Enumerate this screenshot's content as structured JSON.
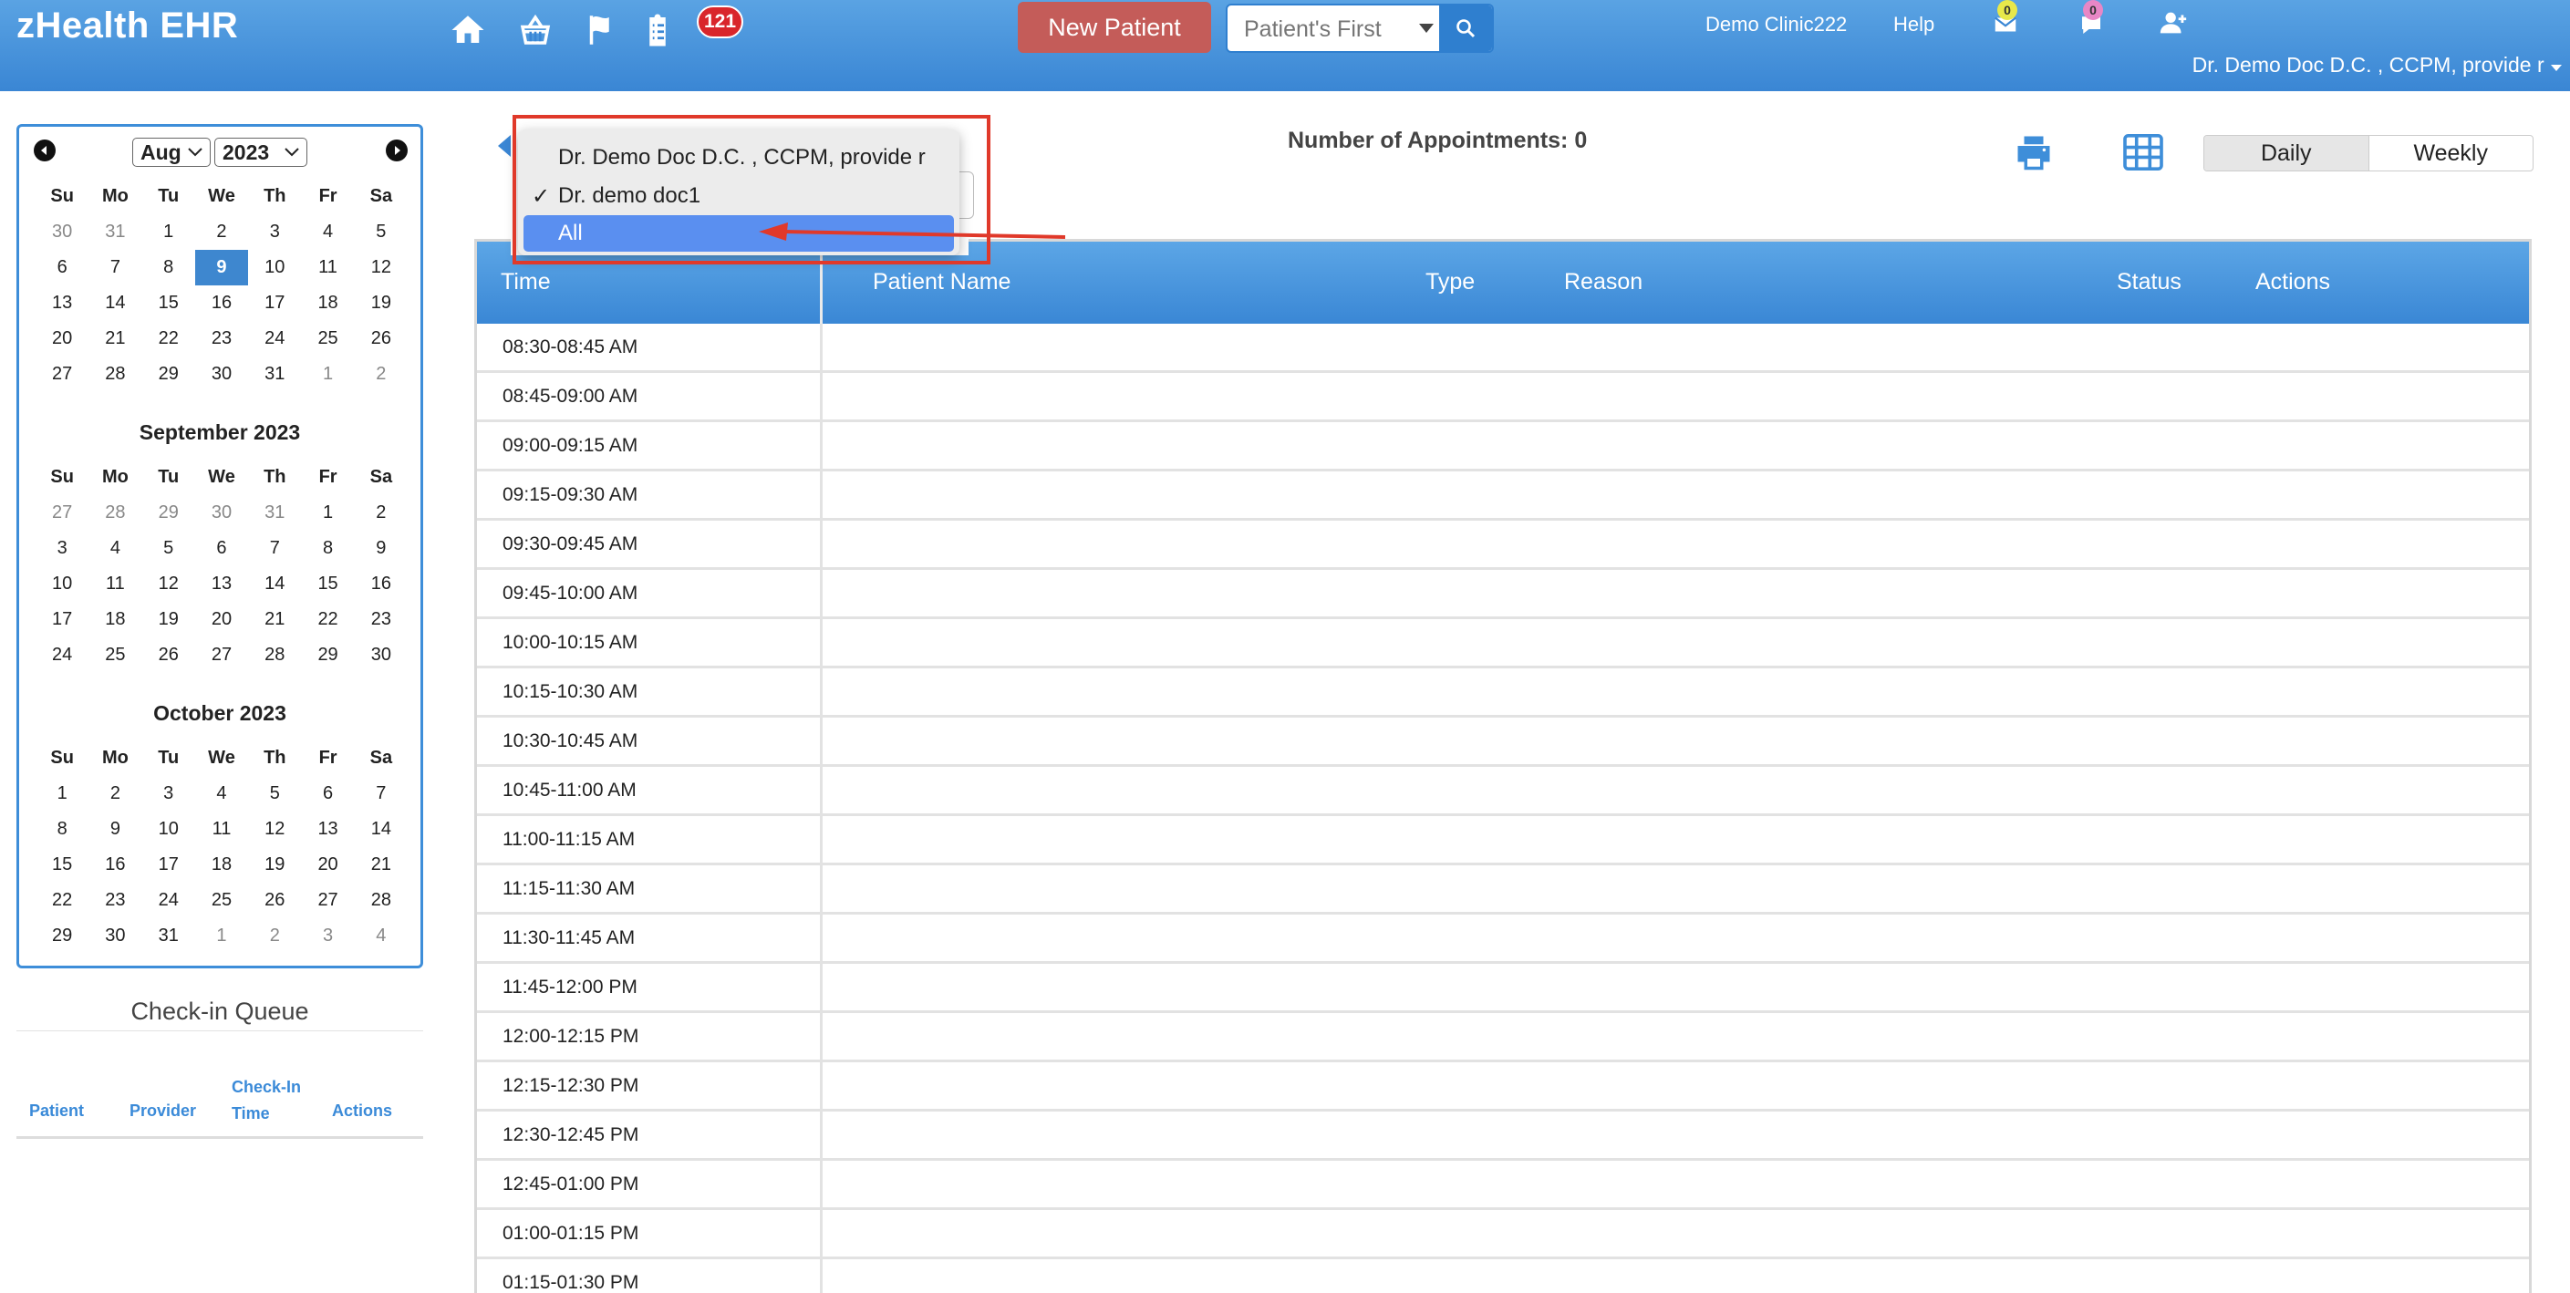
{
  "app": {
    "title": "zHealth EHR",
    "notification_count": "121",
    "new_patient_label": "New Patient",
    "search_placeholder": "Patient's First",
    "clinic_name": "Demo Clinic222",
    "help_label": "Help",
    "mail_count": "0",
    "chat_count": "0",
    "user_label": "Dr. Demo Doc D.C. , CCPM, provide r"
  },
  "colors": {
    "header": "#3a86d4",
    "accent": "#3e87cf",
    "new_patient": "#c45c59",
    "badge_red": "#d9262b",
    "annotation_red": "#e0392a"
  },
  "icons": [
    "home-icon",
    "basket-icon",
    "flag-icon",
    "clipboard-icon",
    "mail-icon",
    "chat-icon",
    "add-user-icon",
    "search-icon",
    "print-icon",
    "grid-icon"
  ],
  "calendar": {
    "month_select": "Aug",
    "year_select": "2023",
    "weekdays": [
      "Su",
      "Mo",
      "Tu",
      "We",
      "Th",
      "Fr",
      "Sa"
    ],
    "months": [
      {
        "title": "",
        "days": [
          {
            "d": "30",
            "o": true
          },
          {
            "d": "31",
            "o": true
          },
          {
            "d": "1"
          },
          {
            "d": "2"
          },
          {
            "d": "3"
          },
          {
            "d": "4"
          },
          {
            "d": "5"
          },
          {
            "d": "6"
          },
          {
            "d": "7"
          },
          {
            "d": "8"
          },
          {
            "d": "9",
            "today": true
          },
          {
            "d": "10"
          },
          {
            "d": "11"
          },
          {
            "d": "12"
          },
          {
            "d": "13"
          },
          {
            "d": "14"
          },
          {
            "d": "15"
          },
          {
            "d": "16"
          },
          {
            "d": "17"
          },
          {
            "d": "18"
          },
          {
            "d": "19"
          },
          {
            "d": "20"
          },
          {
            "d": "21"
          },
          {
            "d": "22"
          },
          {
            "d": "23"
          },
          {
            "d": "24"
          },
          {
            "d": "25"
          },
          {
            "d": "26"
          },
          {
            "d": "27"
          },
          {
            "d": "28"
          },
          {
            "d": "29"
          },
          {
            "d": "30"
          },
          {
            "d": "31"
          },
          {
            "d": "1",
            "o": true
          },
          {
            "d": "2",
            "o": true
          }
        ]
      },
      {
        "title": "September 2023",
        "days": [
          {
            "d": "27",
            "o": true
          },
          {
            "d": "28",
            "o": true
          },
          {
            "d": "29",
            "o": true
          },
          {
            "d": "30",
            "o": true
          },
          {
            "d": "31",
            "o": true
          },
          {
            "d": "1"
          },
          {
            "d": "2"
          },
          {
            "d": "3"
          },
          {
            "d": "4"
          },
          {
            "d": "5"
          },
          {
            "d": "6"
          },
          {
            "d": "7"
          },
          {
            "d": "8"
          },
          {
            "d": "9"
          },
          {
            "d": "10"
          },
          {
            "d": "11"
          },
          {
            "d": "12"
          },
          {
            "d": "13"
          },
          {
            "d": "14"
          },
          {
            "d": "15"
          },
          {
            "d": "16"
          },
          {
            "d": "17"
          },
          {
            "d": "18"
          },
          {
            "d": "19"
          },
          {
            "d": "20"
          },
          {
            "d": "21"
          },
          {
            "d": "22"
          },
          {
            "d": "23"
          },
          {
            "d": "24"
          },
          {
            "d": "25"
          },
          {
            "d": "26"
          },
          {
            "d": "27"
          },
          {
            "d": "28"
          },
          {
            "d": "29"
          },
          {
            "d": "30"
          }
        ]
      },
      {
        "title": "October 2023",
        "days": [
          {
            "d": "1"
          },
          {
            "d": "2"
          },
          {
            "d": "3"
          },
          {
            "d": "4"
          },
          {
            "d": "5"
          },
          {
            "d": "6"
          },
          {
            "d": "7"
          },
          {
            "d": "8"
          },
          {
            "d": "9"
          },
          {
            "d": "10"
          },
          {
            "d": "11"
          },
          {
            "d": "12"
          },
          {
            "d": "13"
          },
          {
            "d": "14"
          },
          {
            "d": "15"
          },
          {
            "d": "16"
          },
          {
            "d": "17"
          },
          {
            "d": "18"
          },
          {
            "d": "19"
          },
          {
            "d": "20"
          },
          {
            "d": "21"
          },
          {
            "d": "22"
          },
          {
            "d": "23"
          },
          {
            "d": "24"
          },
          {
            "d": "25"
          },
          {
            "d": "26"
          },
          {
            "d": "27"
          },
          {
            "d": "28"
          },
          {
            "d": "29"
          },
          {
            "d": "30"
          },
          {
            "d": "31"
          },
          {
            "d": "1",
            "o": true
          },
          {
            "d": "2",
            "o": true
          },
          {
            "d": "3",
            "o": true
          },
          {
            "d": "4",
            "o": true
          }
        ]
      }
    ]
  },
  "checkin_queue": {
    "title": "Check-in Queue",
    "col_patient": "Patient",
    "col_provider": "Provider",
    "col_checkin_1": "Check-In",
    "col_checkin_2": "Time",
    "col_actions": "Actions"
  },
  "schedule": {
    "appointments_label": "Number of Appointments: 0",
    "view_daily": "Daily",
    "view_weekly": "Weekly",
    "columns": {
      "time": "Time",
      "patient_name": "Patient Name",
      "type": "Type",
      "reason": "Reason",
      "status": "Status",
      "actions": "Actions"
    },
    "slots": [
      "08:30-08:45 AM",
      "08:45-09:00 AM",
      "09:00-09:15 AM",
      "09:15-09:30 AM",
      "09:30-09:45 AM",
      "09:45-10:00 AM",
      "10:00-10:15 AM",
      "10:15-10:30 AM",
      "10:30-10:45 AM",
      "10:45-11:00 AM",
      "11:00-11:15 AM",
      "11:15-11:30 AM",
      "11:30-11:45 AM",
      "11:45-12:00 PM",
      "12:00-12:15 PM",
      "12:15-12:30 PM",
      "12:30-12:45 PM",
      "12:45-01:00 PM",
      "01:00-01:15 PM",
      "01:15-01:30 PM"
    ]
  },
  "provider_dropdown": {
    "options": [
      {
        "label": "Dr. Demo Doc D.C. , CCPM, provide r",
        "checked": false,
        "highlighted": false
      },
      {
        "label": "Dr. demo doc1",
        "checked": true,
        "highlighted": false
      },
      {
        "label": "All",
        "checked": false,
        "highlighted": true
      }
    ]
  }
}
